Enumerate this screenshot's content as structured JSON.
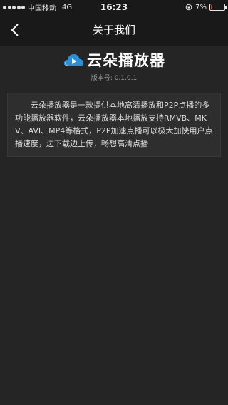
{
  "status_bar": {
    "carrier": "中国移动",
    "network": "4G",
    "time": "16:23",
    "battery_text": "7%",
    "battery_level": 0.07
  },
  "nav": {
    "title": "关于我们",
    "back_icon": "chevron-left-icon"
  },
  "about": {
    "app_name": "云朵播放器",
    "logo_icon": "cloud-play-icon",
    "version_label": "版本号:",
    "version_value": "0.1.0.1",
    "description": "云朵播放器是一款提供本地高清播放和P2P点播的多功能播放器软件，云朵播放器本地播放支持RMVB、MKV、AVI、MP4等格式，P2P加速点播可以极大加快用户点播速度，边下载边上传，畅想高清点播"
  },
  "colors": {
    "background": "#252525",
    "bar": "#191919",
    "card": "#2e2e2e",
    "logo_blue": "#2e8fd6"
  }
}
